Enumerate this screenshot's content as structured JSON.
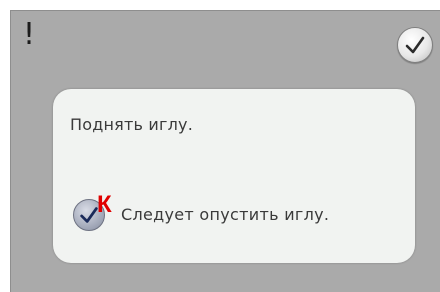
{
  "header": {
    "alert_icon": "exclamation-icon",
    "alert_text": "!",
    "ok_icon": "checkmark-icon"
  },
  "dialog": {
    "message": "Поднять иглу.",
    "hint_icon": "checkmark-icon",
    "marker": "К",
    "hint_text": "Следует опустить иглу."
  },
  "colors": {
    "panel_background": "#aaaaaa",
    "dialog_background": "#f1f3f1",
    "marker": "#e00000"
  }
}
